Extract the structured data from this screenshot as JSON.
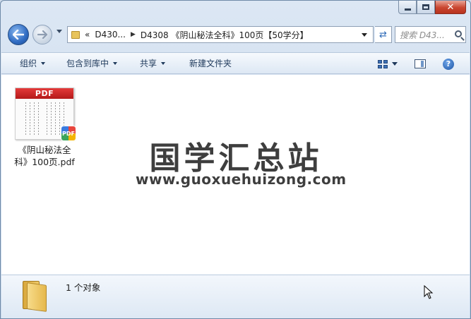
{
  "window": {
    "caption": {
      "minimize": "–",
      "maximize": "□",
      "close": "✕"
    }
  },
  "nav": {
    "address_prefix": "«",
    "breadcrumb_parent": "D430...",
    "breadcrumb_current": "D4308 《阴山秘法全科》100页【50学分】",
    "search_placeholder": "搜索 D43..."
  },
  "toolbar": {
    "organize": "组织",
    "include_library": "包含到库中",
    "share": "共享",
    "new_folder": "新建文件夹",
    "help": "?"
  },
  "files": [
    {
      "name_line1": "《阴山秘法全",
      "name_line2": "科》100页.pdf",
      "thumb_band": "PDF",
      "badge": "PDF"
    }
  ],
  "watermark": {
    "title": "国学汇总站",
    "url": "www.guoxuehuizong.com"
  },
  "status": {
    "count_text": "1 个对象"
  },
  "colors": {
    "pdf_red": "#c8241f",
    "accent_blue": "#2f6bc2"
  }
}
